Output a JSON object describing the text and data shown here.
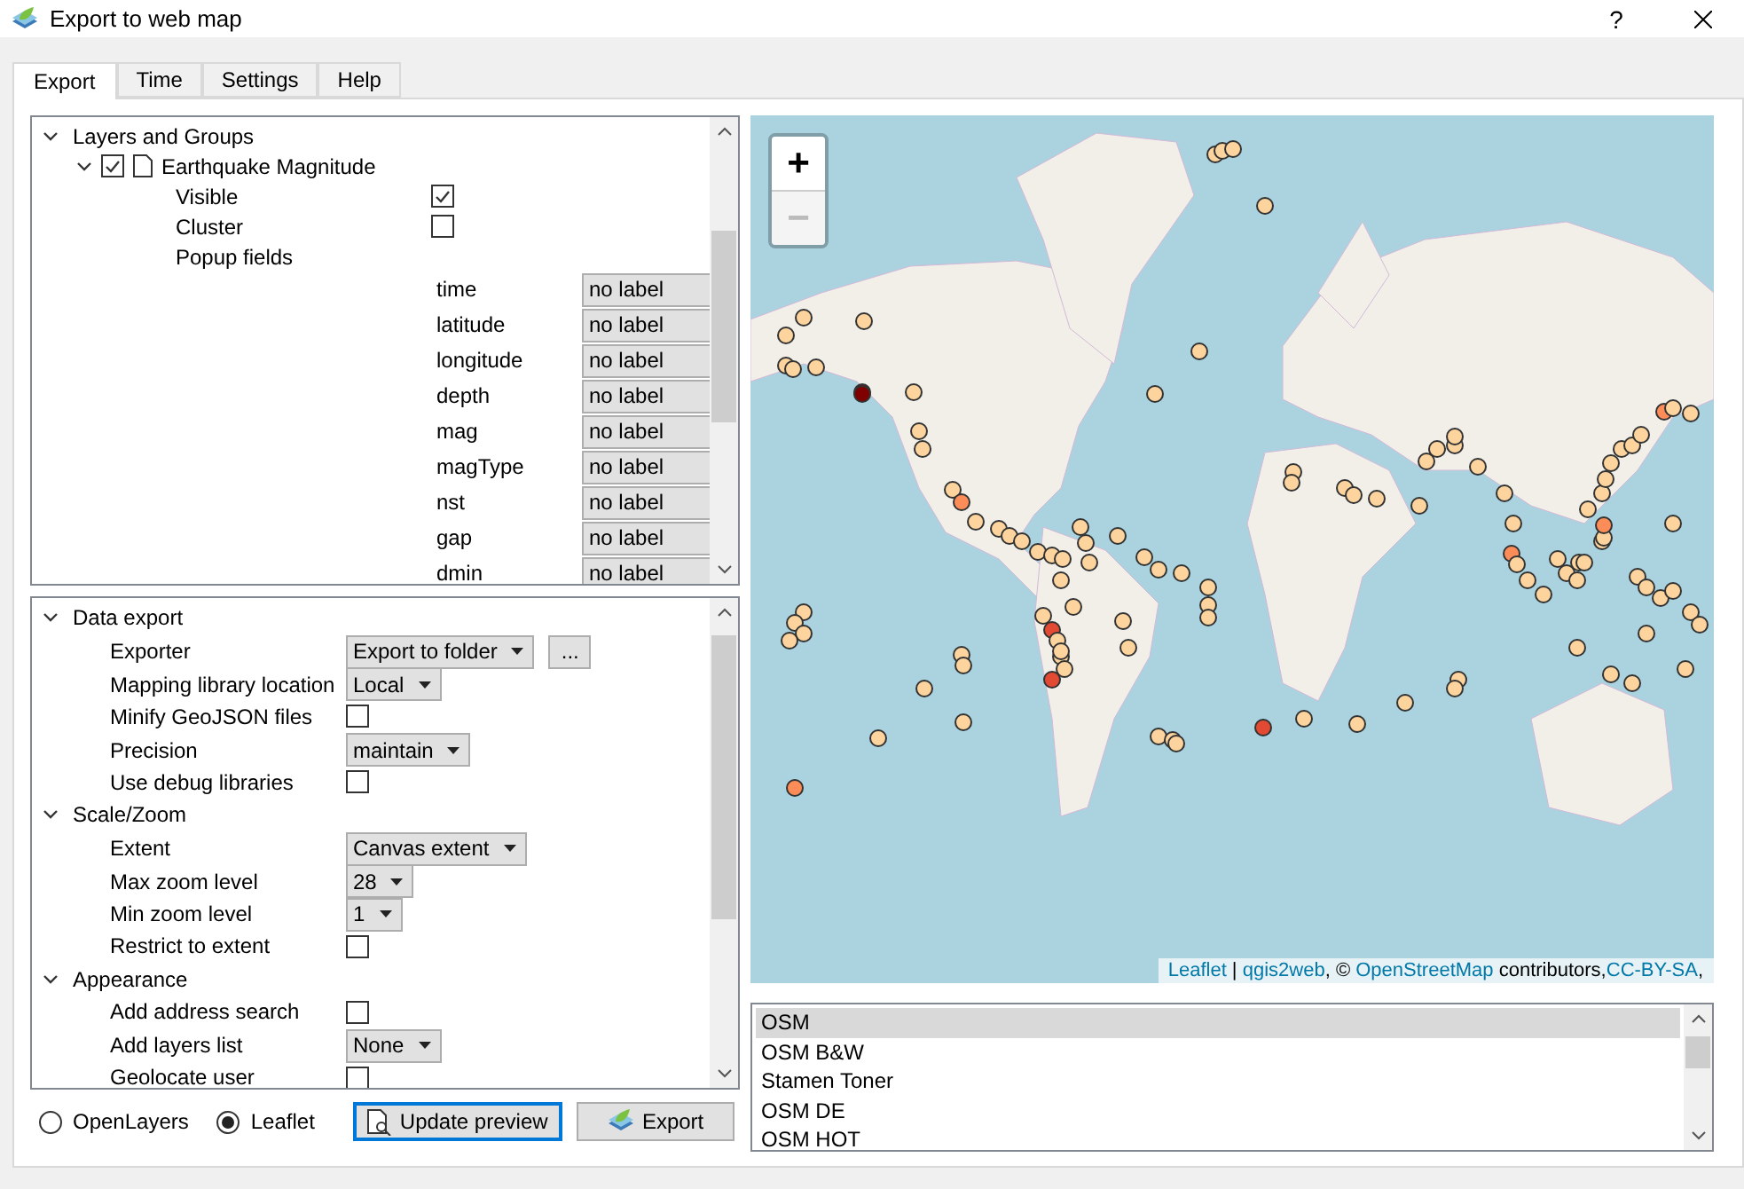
{
  "window": {
    "title": "Export to web map",
    "help_label": "?"
  },
  "tabs": [
    {
      "label": "Export",
      "selected": true
    },
    {
      "label": "Time",
      "selected": false
    },
    {
      "label": "Settings",
      "selected": false
    },
    {
      "label": "Help",
      "selected": false
    }
  ],
  "layers_tree": {
    "group": {
      "label": "Layers and Groups",
      "expanded": true
    },
    "layer": {
      "name": "Earthquake Magnitude",
      "expanded": true,
      "checked": true
    },
    "options": [
      {
        "label": "Visible",
        "checked": true
      },
      {
        "label": "Cluster",
        "checked": false
      }
    ],
    "popup_label": "Popup fields",
    "fields": [
      {
        "name": "time",
        "value": "no label"
      },
      {
        "name": "latitude",
        "value": "no label"
      },
      {
        "name": "longitude",
        "value": "no label"
      },
      {
        "name": "depth",
        "value": "no label"
      },
      {
        "name": "mag",
        "value": "no label"
      },
      {
        "name": "magType",
        "value": "no label"
      },
      {
        "name": "nst",
        "value": "no label"
      },
      {
        "name": "gap",
        "value": "no label"
      },
      {
        "name": "dmin",
        "value": "no label"
      }
    ]
  },
  "settings_tree": [
    {
      "title": "Data export",
      "expanded": true,
      "rows": [
        {
          "label": "Exporter",
          "kind": "select",
          "value": "Export to folder",
          "button": "..."
        },
        {
          "label": "Mapping library location",
          "kind": "select",
          "value": "Local"
        },
        {
          "label": "Minify GeoJSON files",
          "kind": "checkbox",
          "checked": false
        },
        {
          "label": "Precision",
          "kind": "select",
          "value": "maintain"
        },
        {
          "label": "Use debug libraries",
          "kind": "checkbox",
          "checked": false
        }
      ]
    },
    {
      "title": "Scale/Zoom",
      "expanded": true,
      "rows": [
        {
          "label": "Extent",
          "kind": "select",
          "value": "Canvas extent"
        },
        {
          "label": "Max zoom level",
          "kind": "select",
          "value": "28"
        },
        {
          "label": "Min zoom level",
          "kind": "select",
          "value": "1"
        },
        {
          "label": "Restrict to extent",
          "kind": "checkbox",
          "checked": false
        }
      ]
    },
    {
      "title": "Appearance",
      "expanded": true,
      "rows": [
        {
          "label": "Add address search",
          "kind": "checkbox",
          "checked": false
        },
        {
          "label": "Add layers list",
          "kind": "select",
          "value": "None"
        },
        {
          "label": "Geolocate user",
          "kind": "checkbox",
          "checked": false
        }
      ]
    }
  ],
  "renderers": [
    {
      "label": "OpenLayers",
      "selected": false
    },
    {
      "label": "Leaflet",
      "selected": true
    }
  ],
  "buttons": {
    "update_preview": "Update preview",
    "export": "Export"
  },
  "map": {
    "zoom_in": "+",
    "zoom_out": "−",
    "zoom_out_disabled": true,
    "attribution": [
      {
        "kind": "link",
        "text": "Leaflet"
      },
      {
        "kind": "plain",
        "text": " | "
      },
      {
        "kind": "link",
        "text": "qgis2web"
      },
      {
        "kind": "plain",
        "text": ", © "
      },
      {
        "kind": "link",
        "text": "OpenStreetMap"
      },
      {
        "kind": "plain",
        "text": " contributors,"
      },
      {
        "kind": "link",
        "text": "CC-BY-SA"
      },
      {
        "kind": "plain",
        "text": ","
      }
    ]
  },
  "basemaps": [
    {
      "label": "OSM",
      "selected": true
    },
    {
      "label": "OSM B&W",
      "selected": false
    },
    {
      "label": "Stamen Toner",
      "selected": false
    },
    {
      "label": "OSM DE",
      "selected": false
    },
    {
      "label": "OSM HOT",
      "selected": false
    }
  ]
}
